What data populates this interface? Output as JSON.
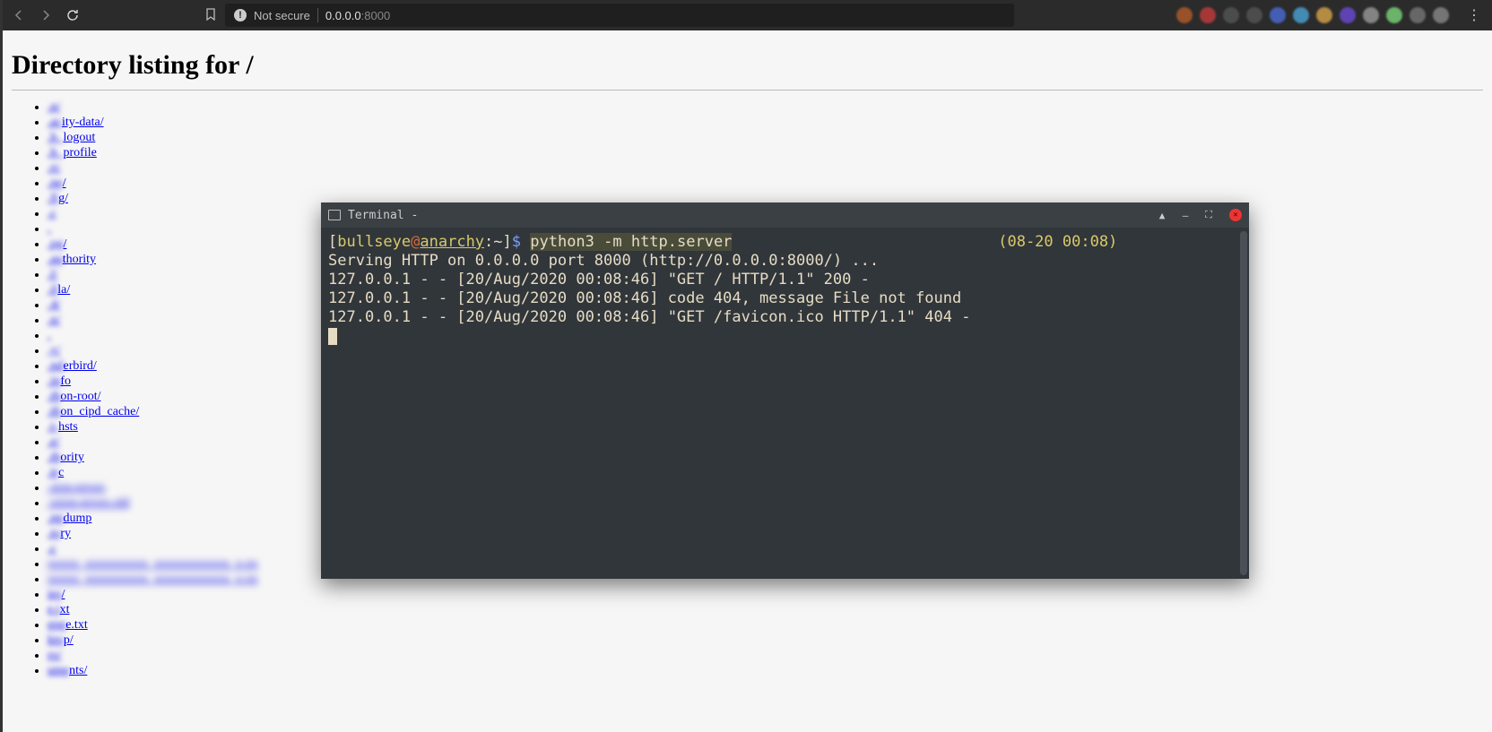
{
  "browser": {
    "not_secure_label": "Not secure",
    "url_host": "0.0.0.0",
    "url_port": ":8000"
  },
  "page": {
    "heading": "Directory listing for /",
    "listing": [
      ".n/",
      ".acity-data/",
      ".h_logout",
      ".h_profile",
      ".rc",
      ".ne/",
      ".fig/",
      ".c",
      ".",
      ".pg/",
      ".authority",
      ".l/",
      ".illa/",
      ".4/",
      ".n/",
      ".",
      ".y/",
      ".nderbird/",
      ".info",
      ".thon-root/",
      ".thon_cipd_cache/",
      ".t-hsts",
      ".e/",
      ".thority",
      ".trc",
      ".sion-errors",
      ".ssion-errors.old",
      ".npdump",
      ".tory",
      ".c",
      "xxxxx_xxxxxxxxxx_xxxxxxxxxxxx_x.xx",
      "xxxxx_xxxxxxxxxx_xxxxxxxxxxxx_x.xx",
      "ies/",
      "e.txt",
      "enge.txt",
      "ktop/",
      "ro/",
      "uments/"
    ],
    "blur_prefix": 3,
    "heavy_blur_rows": [
      25,
      26,
      30,
      31
    ]
  },
  "terminal": {
    "title": "Terminal -",
    "prompt": {
      "user": "bullseye",
      "at": "@",
      "host": "anarchy",
      "path": ":~",
      "command": "python3 -m http.server",
      "timestamp": "(08-20 00:08)"
    },
    "lines": [
      "Serving HTTP on 0.0.0.0 port 8000 (http://0.0.0.0:8000/) ...",
      "127.0.0.1 - - [20/Aug/2020 00:08:46] \"GET / HTTP/1.1\" 200 -",
      "127.0.0.1 - - [20/Aug/2020 00:08:46] code 404, message File not found",
      "127.0.0.1 - - [20/Aug/2020 00:08:46] \"GET /favicon.ico HTTP/1.1\" 404 -"
    ]
  },
  "ext_colors": [
    "#b35c2a",
    "#c43b3b",
    "#555",
    "#555",
    "#4a6bd6",
    "#4aa3d6",
    "#d6a34a",
    "#6b4ad6",
    "#999",
    "#7ad67a",
    "#777",
    "#888"
  ]
}
